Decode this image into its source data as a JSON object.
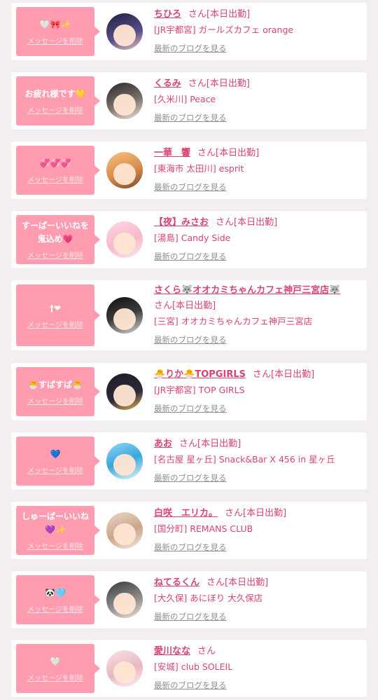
{
  "colors": {
    "accent": "#ff9cb0",
    "link": "#d8446f",
    "muted": "#8f8f8f",
    "background": "#f3eeef"
  },
  "items": [
    {
      "message": "🤍🎀✨",
      "delete_label": "メッセージを削除",
      "name": "ちひろ",
      "suffix": "さん",
      "status": "[本日出勤]",
      "shop": "[JR宇都宮] ガールズカフェ orange",
      "blog_label": "最新のブログを見る"
    },
    {
      "message": "お疲れ様です💛",
      "delete_label": "メッセージを削除",
      "name": "くるみ",
      "suffix": "さん",
      "status": "[本日出勤]",
      "shop": "[久米川] Peace",
      "blog_label": "最新のブログを見る"
    },
    {
      "message": "💞💞💞",
      "delete_label": "メッセージを削除",
      "name": "一華　響",
      "suffix": "さん",
      "status": "[本日出勤]",
      "shop": "[東海市 太田川] esprit",
      "blog_label": "最新のブログを見る"
    },
    {
      "message": "すーぱーいいねを鬼込め💗",
      "delete_label": "メッセージを削除",
      "name": "【夜】みさお",
      "suffix": "さん",
      "status": "[本日出勤]",
      "shop": "[湯島] Candy Side",
      "blog_label": "最新のブログを見る"
    },
    {
      "message": "†❤",
      "delete_label": "メッセージを削除",
      "name": "さくら🐺オオカミちゃんカフェ神戸三宮店🐺",
      "suffix": "さん",
      "status": "[本日出勤]",
      "shop": "[三宮] オオカミちゃんカフェ神戸三宮店",
      "blog_label": "最新のブログを見る"
    },
    {
      "message": "🐣すばすば🐣",
      "delete_label": "メッセージを削除",
      "name": "🐣りか🐣TOPGIRLS",
      "suffix": "さん",
      "status": "[本日出勤]",
      "shop": "[JR宇都宮] TOP GIRLS",
      "blog_label": "最新のブログを見る"
    },
    {
      "message": "💙",
      "delete_label": "メッセージを削除",
      "name": "あお",
      "suffix": "さん",
      "status": "[本日出勤]",
      "shop": "[名古屋 星ヶ丘] Snack&Bar X 456 in 星ヶ丘",
      "blog_label": "最新のブログを見る"
    },
    {
      "message": "しゅーぱーいいね💜✨",
      "delete_label": "メッセージを削除",
      "name": "白咲　エリカ。",
      "suffix": "さん",
      "status": "[本日出勤]",
      "shop": "[国分町] REMANS CLUB",
      "blog_label": "最新のブログを見る"
    },
    {
      "message": "🐼🩵",
      "delete_label": "メッセージを削除",
      "name": "ねてるくん",
      "suffix": "さん",
      "status": "[本日出勤]",
      "shop": "[大久保] あにぼり 大久保店",
      "blog_label": "最新のブログを見る"
    },
    {
      "message": "🤍",
      "delete_label": "メッセージを削除",
      "name": "愛川なな",
      "suffix": "さん",
      "status": "",
      "shop": "[安城] club SOLEIL",
      "blog_label": "最新のブログを見る"
    }
  ]
}
